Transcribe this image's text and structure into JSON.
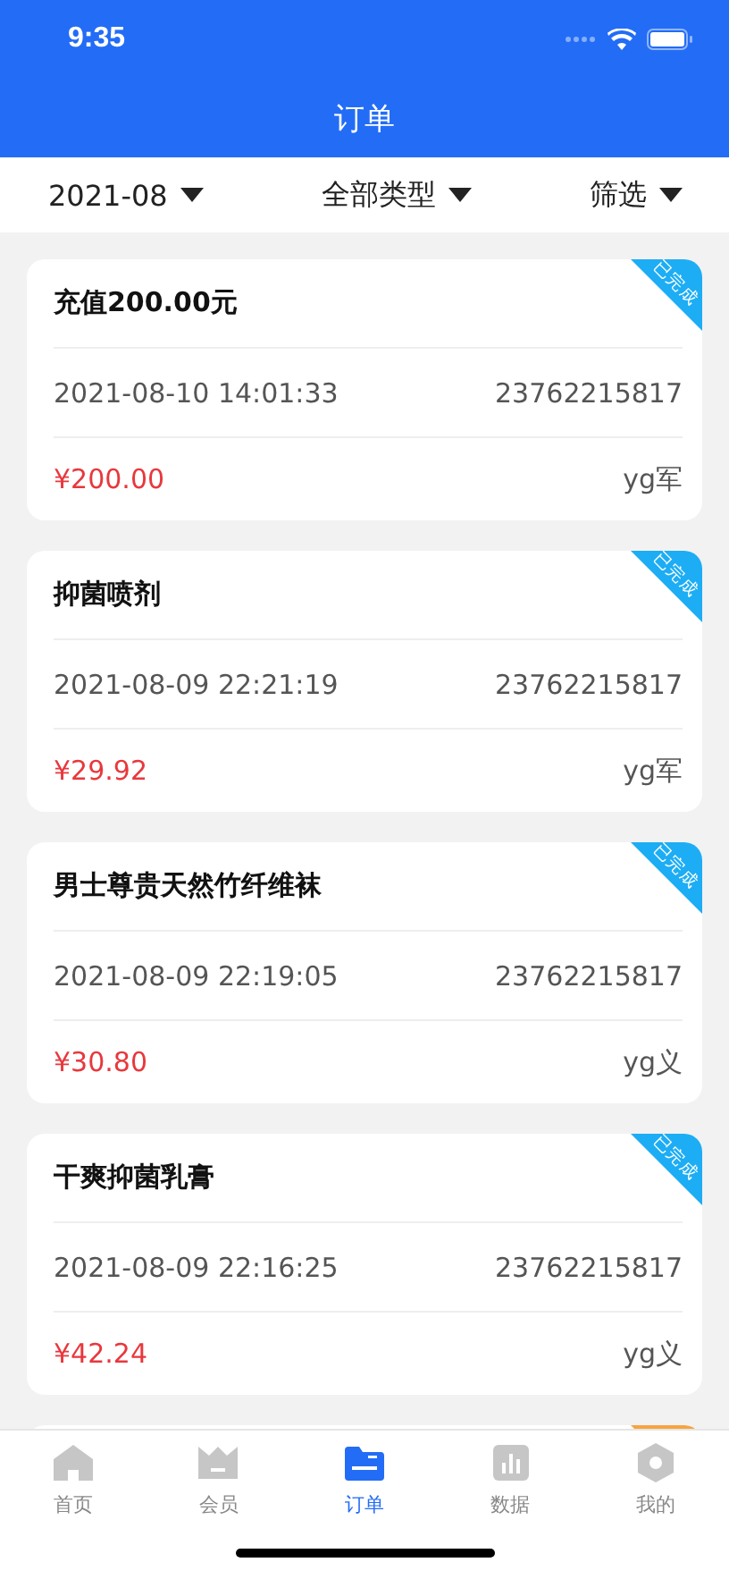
{
  "status_bar": {
    "time": "9:35"
  },
  "nav": {
    "title": "订单"
  },
  "filters": [
    {
      "label": "2021-08"
    },
    {
      "label": "全部类型"
    },
    {
      "label": "筛选"
    }
  ],
  "orders": [
    {
      "kind": "card",
      "title": "充值200.00元",
      "status": "已完成",
      "color": "#1dadf4",
      "datetime": "2021-08-10 14:01:33",
      "order_no": "23762215817",
      "amount": "¥200.00",
      "staff": "yg军"
    },
    {
      "kind": "card",
      "title": "抑菌喷剂",
      "status": "已完成",
      "color": "#1dadf4",
      "datetime": "2021-08-09 22:21:19",
      "order_no": "23762215817",
      "amount": "¥29.92",
      "staff": "yg军"
    },
    {
      "kind": "card",
      "title": "男士尊贵天然竹纤维袜",
      "status": "已完成",
      "color": "#1dadf4",
      "datetime": "2021-08-09 22:19:05",
      "order_no": "23762215817",
      "amount": "¥30.80",
      "staff": "yg义"
    },
    {
      "kind": "card",
      "title": "干爽抑菌乳膏",
      "status": "已完成",
      "color": "#1dadf4",
      "datetime": "2021-08-09 22:16:25",
      "order_no": "23762215817",
      "amount": "¥42.24",
      "staff": "yg义"
    },
    {
      "kind": "peek",
      "color": "#f7a440"
    }
  ],
  "tab_bar": [
    {
      "label": "首页",
      "selected": false
    },
    {
      "label": "会员",
      "selected": false
    },
    {
      "label": "订单",
      "selected": true
    },
    {
      "label": "数据",
      "selected": false
    },
    {
      "label": "我的",
      "selected": false
    }
  ]
}
